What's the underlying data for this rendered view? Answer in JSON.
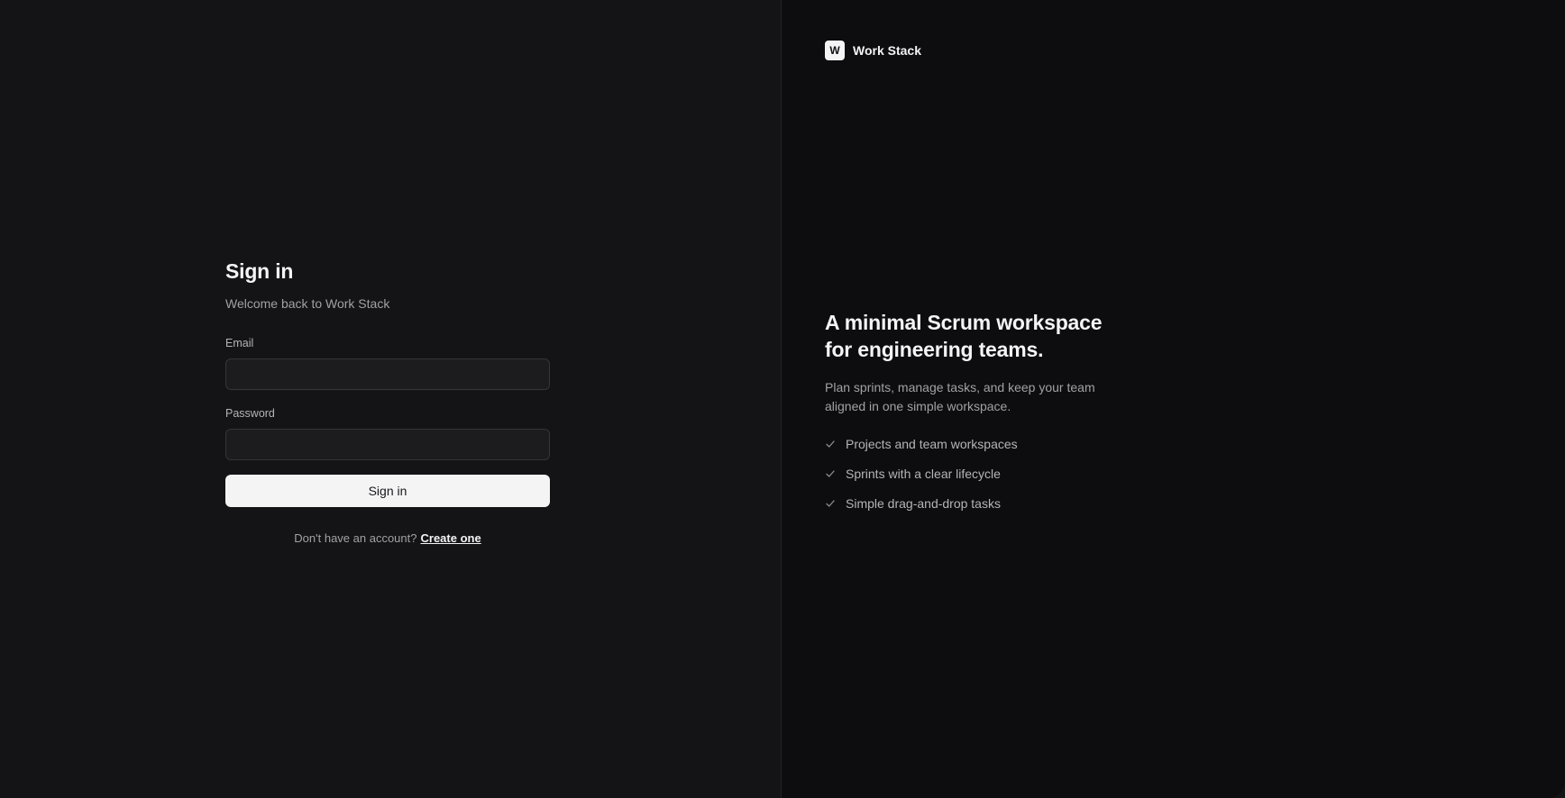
{
  "signin": {
    "title": "Sign in",
    "subtitle": "Welcome back to Work Stack",
    "email_label": "Email",
    "email_value": "",
    "email_placeholder": "",
    "password_label": "Password",
    "password_value": "",
    "password_placeholder": "",
    "submit_label": "Sign in",
    "account_prompt": "Don't have an account?",
    "create_link": "Create one"
  },
  "brand": {
    "logo_letter": "W",
    "name": "Work Stack"
  },
  "marketing": {
    "headline": "A minimal Scrum workspace for engineering teams.",
    "description": "Plan sprints, manage tasks, and keep your team aligned in one simple workspace.",
    "features": [
      {
        "icon": "check-icon",
        "label": "Projects and team workspaces"
      },
      {
        "icon": "check-icon",
        "label": "Sprints with a clear lifecycle"
      },
      {
        "icon": "check-icon",
        "label": "Simple drag-and-drop tasks"
      }
    ]
  },
  "colors": {
    "left_background": "#141416",
    "right_background": "#0d0d0f",
    "button_background": "#f4f4f5",
    "muted_text": "#a1a1a6"
  }
}
